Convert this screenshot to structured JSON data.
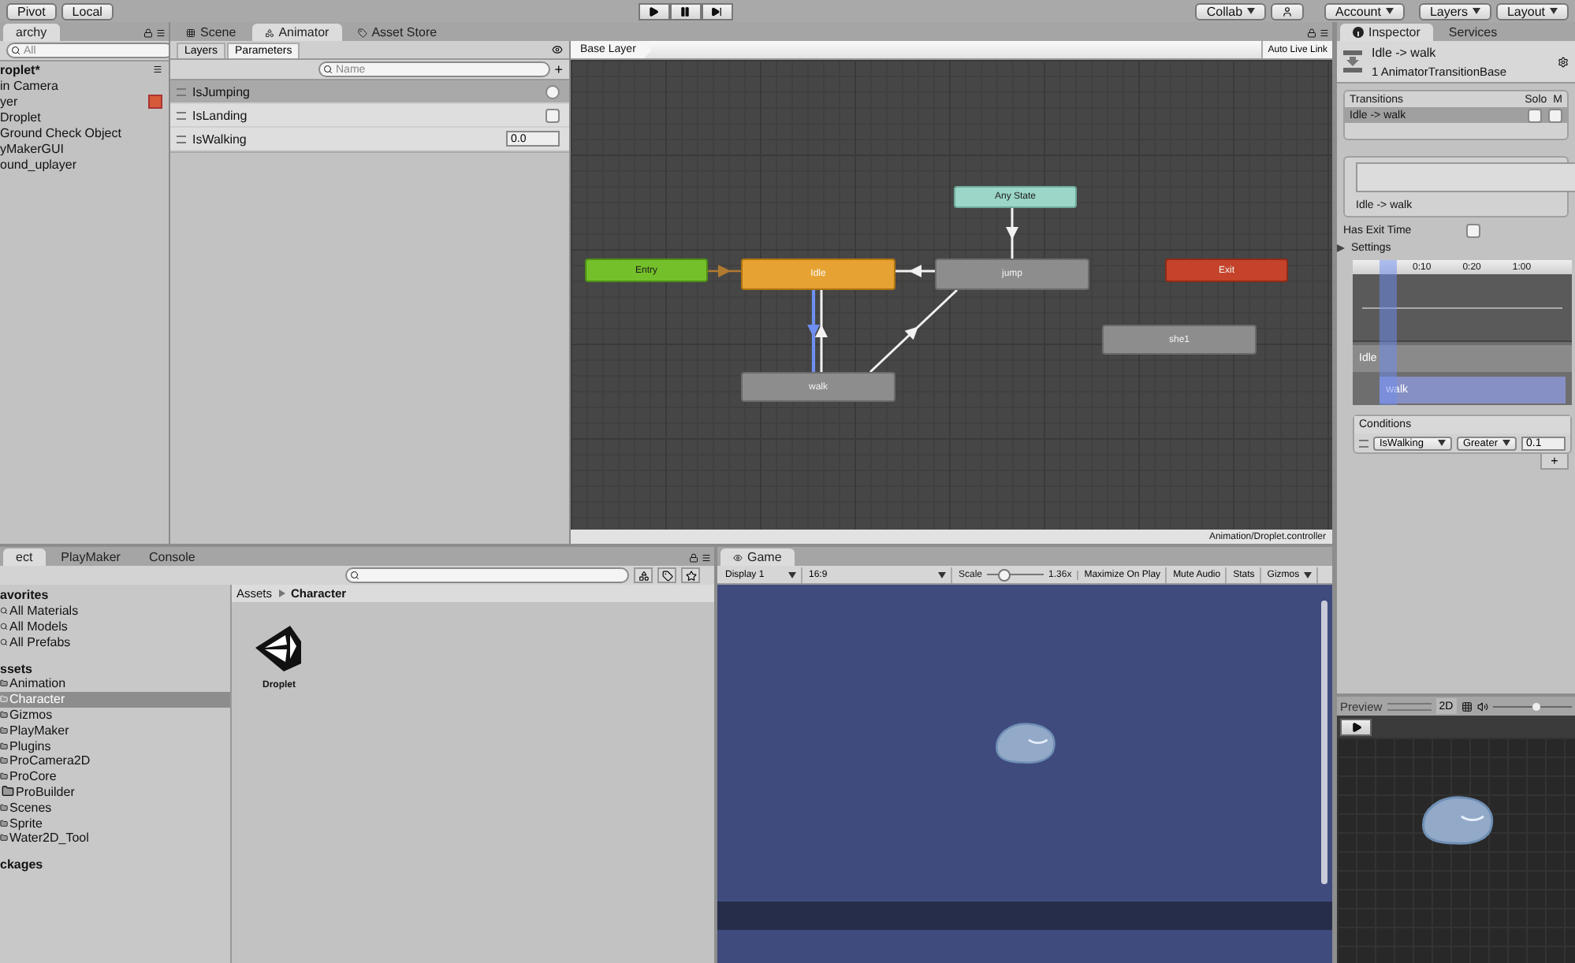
{
  "toolbar": {
    "buttons": [
      {
        "label": "Pivot"
      },
      {
        "label": "Local"
      }
    ],
    "collab": "Collab",
    "account": "Account",
    "layers": "Layers",
    "layout": "Layout"
  },
  "hierarchy": {
    "tab": "archy",
    "search": {
      "placeholder": "All"
    },
    "scene": "roplet*",
    "items": [
      {
        "label": "in Camera",
        "badge": false
      },
      {
        "label": "yer",
        "badge": true
      },
      {
        "label": "Droplet",
        "badge": false
      },
      {
        "label": "Ground Check Object",
        "badge": false
      },
      {
        "label": "yMakerGUI",
        "badge": false
      },
      {
        "label": "ound_uplayer",
        "badge": false
      }
    ]
  },
  "animator": {
    "tabs": [
      {
        "label": "Scene",
        "selected": false
      },
      {
        "label": "Animator",
        "selected": true
      },
      {
        "label": "Asset Store",
        "selected": false
      }
    ],
    "subtabs": [
      {
        "label": "Layers",
        "selected": false
      },
      {
        "label": "Parameters",
        "selected": true
      }
    ],
    "search": {
      "placeholder": "Name"
    },
    "add_button": "+",
    "parameters": [
      {
        "name": "IsJumping",
        "kind": "trigger",
        "selected": true,
        "checked": false
      },
      {
        "name": "IsLanding",
        "kind": "bool",
        "selected": false,
        "checked": false
      },
      {
        "name": "IsWalking",
        "kind": "float",
        "selected": false,
        "value": "0.0"
      }
    ],
    "breadcrumb": "Base Layer",
    "live_link": "Auto Live Link",
    "states": [
      {
        "label": "Entry",
        "kind": "entry"
      },
      {
        "label": "Idle",
        "kind": "default"
      },
      {
        "label": "jump",
        "kind": "state"
      },
      {
        "label": "Any State",
        "kind": "any"
      },
      {
        "label": "Exit",
        "kind": "exit"
      },
      {
        "label": "she1",
        "kind": "state"
      },
      {
        "label": "walk",
        "kind": "state"
      }
    ],
    "transitions": [
      {
        "kind": "entry",
        "selected": false
      },
      {
        "kind": "normal",
        "selected": false
      },
      {
        "kind": "normal",
        "selected": false
      },
      {
        "kind": "normal",
        "selected": true
      },
      {
        "kind": "normal",
        "selected": false
      },
      {
        "kind": "normal",
        "selected": false
      }
    ],
    "path": "Animation/Droplet.controller"
  },
  "inspector": {
    "tabs": [
      {
        "label": "Inspector",
        "selected": true
      },
      {
        "label": "Services",
        "selected": false
      }
    ],
    "title": "Idle -> walk",
    "subtitle": "1 AnimatorTransitionBase",
    "transitions": {
      "columns": [
        "Transitions",
        "Solo",
        "M"
      ],
      "rows": [
        {
          "label": "Idle -> walk",
          "selected": true,
          "solo": false,
          "mute": false
        }
      ]
    },
    "transition_label": "Idle -> walk",
    "has_exit_time": {
      "label": "Has Exit Time",
      "checked": false
    },
    "settings": {
      "label": "Settings",
      "expanded": false
    },
    "timeline": {
      "ticks": [
        "0:10",
        "0:20",
        "1:00"
      ],
      "tracks": [
        {
          "label": "Idle"
        },
        {
          "label": "walk"
        }
      ]
    },
    "conditions": {
      "title": "Conditions",
      "rows": [
        {
          "parameter": "IsWalking",
          "mode": "Greater",
          "value": "0.1"
        }
      ],
      "add_button": "+"
    }
  },
  "project": {
    "tabs": [
      {
        "label": "ect",
        "selected": true
      },
      {
        "label": "PlayMaker",
        "selected": false
      },
      {
        "label": "Console",
        "selected": false
      }
    ],
    "tree": [
      {
        "label": "avorites",
        "kind": "header",
        "selected": false,
        "children": [
          {
            "label": "All Materials",
            "kind": "search",
            "selected": false
          },
          {
            "label": "All Models",
            "kind": "search",
            "selected": false
          },
          {
            "label": "All Prefabs",
            "kind": "search",
            "selected": false
          }
        ]
      },
      {
        "label": "ssets",
        "kind": "header",
        "selected": false,
        "children": [
          {
            "label": "Animation",
            "kind": "folder",
            "selected": false
          },
          {
            "label": "Character",
            "kind": "folder",
            "selected": true
          },
          {
            "label": "Gizmos",
            "kind": "folder",
            "selected": false
          },
          {
            "label": "PlayMaker",
            "kind": "folder",
            "selected": false
          },
          {
            "label": "Plugins",
            "kind": "folder",
            "selected": false
          },
          {
            "label": "ProCamera2D",
            "kind": "folder",
            "selected": false
          },
          {
            "label": "ProCore",
            "kind": "folder",
            "selected": false,
            "children": [
              {
                "label": "ProBuilder",
                "kind": "folder",
                "selected": false
              }
            ]
          },
          {
            "label": "Scenes",
            "kind": "folder",
            "selected": false
          },
          {
            "label": "Sprite",
            "kind": "folder",
            "selected": false
          },
          {
            "label": "Water2D_Tool",
            "kind": "folder",
            "selected": false
          }
        ]
      },
      {
        "label": "ckages",
        "kind": "header",
        "selected": false
      }
    ],
    "breadcrumb": [
      "Assets",
      "Character"
    ],
    "assets": [
      {
        "label": "Droplet"
      }
    ]
  },
  "game": {
    "tab": "Game",
    "display": "Display 1",
    "aspect": "16:9",
    "scale_label": "Scale",
    "scale": {
      "level": 0.3
    },
    "scale_value": "1.36x",
    "buttons": [
      "Maximize On Play",
      "Mute Audio",
      "Stats"
    ],
    "gizmos": "Gizmos"
  },
  "preview": {
    "title": "Preview",
    "mode": "2D",
    "speed": {
      "level": 0.55
    }
  }
}
